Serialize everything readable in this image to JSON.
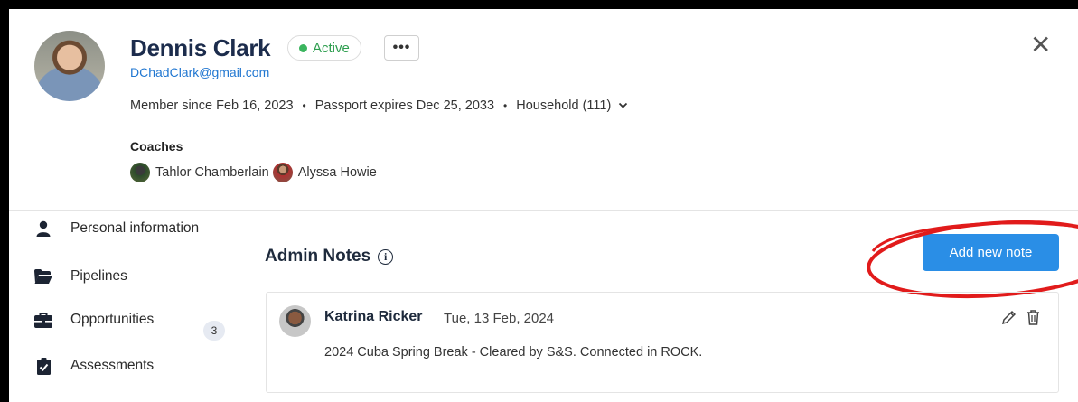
{
  "profile": {
    "name": "Dennis Clark",
    "status": "Active",
    "more_label": "•••",
    "email": "DChadClark@gmail.com",
    "member_since": "Member since Feb 16, 2023",
    "passport": "Passport expires Dec 25, 2033",
    "household": "Household (111)",
    "separator": "•",
    "close_label": "✕"
  },
  "coaches": {
    "label": "Coaches",
    "items": [
      "Tahlor Chamberlain",
      "Alyssa Howie"
    ]
  },
  "sidebar": {
    "items": [
      {
        "label": "Personal information",
        "icon": "person-icon"
      },
      {
        "label": "Pipelines",
        "icon": "folder-icon"
      },
      {
        "label": "Opportunities",
        "icon": "briefcase-icon",
        "count": "3"
      },
      {
        "label": "Assessments",
        "icon": "clipboard-check-icon"
      }
    ]
  },
  "main": {
    "title": "Admin Notes",
    "info_icon": "i",
    "add_button": "Add new note",
    "notes": [
      {
        "author": "Katrina Ricker",
        "date": "Tue, 13 Feb, 2024",
        "text": "2024 Cuba Spring Break - Cleared by S&S. Connected in ROCK."
      }
    ]
  },
  "colors": {
    "accent": "#2a8ee6",
    "active_green": "#3bb55e",
    "highlight_red": "#e11b1b",
    "name_navy": "#1c2c4c"
  }
}
